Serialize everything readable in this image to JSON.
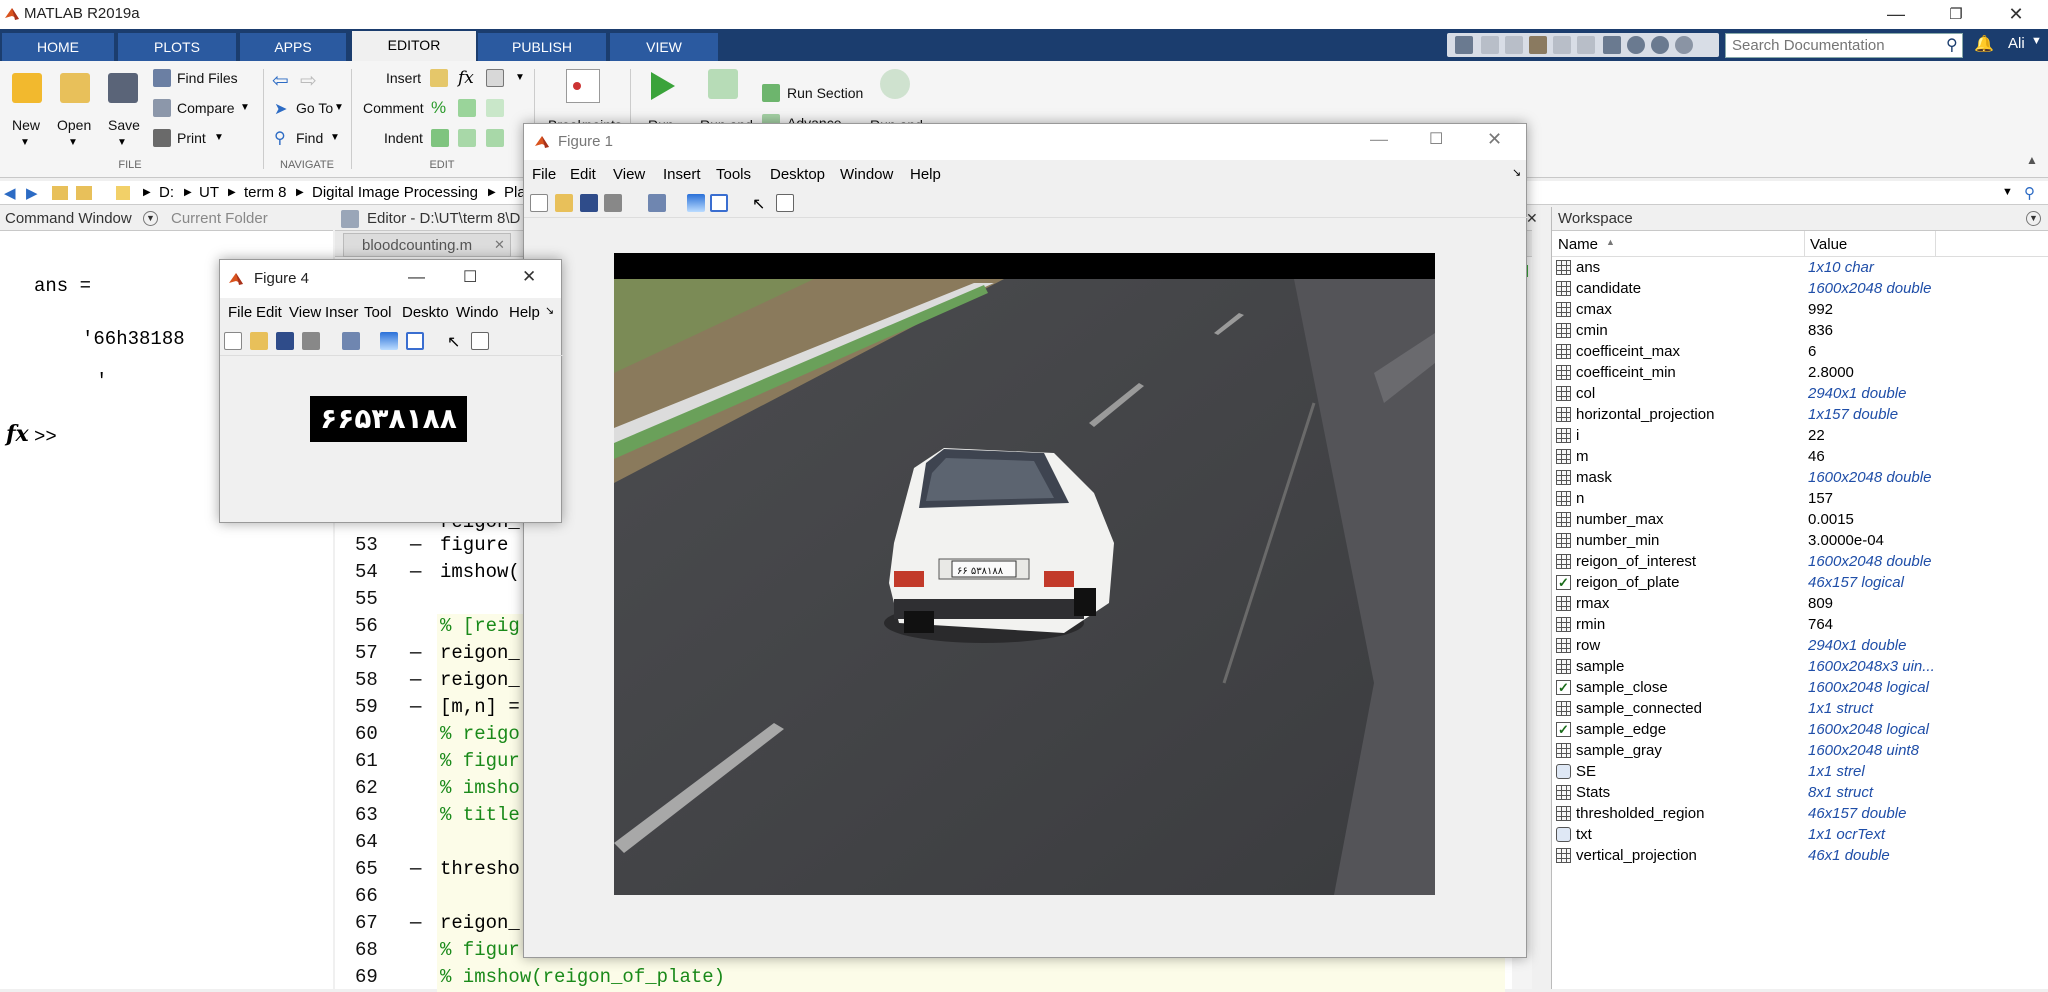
{
  "app": {
    "title": "MATLAB R2019a",
    "user": "Ali",
    "search_placeholder": "Search Documentation"
  },
  "ribbon": {
    "tabs": [
      "HOME",
      "PLOTS",
      "APPS",
      "EDITOR",
      "PUBLISH",
      "VIEW"
    ],
    "active_tab": "EDITOR",
    "file": {
      "new": "New",
      "open": "Open",
      "save": "Save",
      "find_files": "Find Files",
      "compare": "Compare",
      "print": "Print",
      "section": "FILE"
    },
    "navigate": {
      "go_to": "Go To",
      "find": "Find",
      "section": "NAVIGATE"
    },
    "edit": {
      "insert": "Insert",
      "comment": "Comment",
      "indent": "Indent",
      "section": "EDIT"
    },
    "run": {
      "breakpoints": "Breakpoints",
      "run": "Run",
      "run_and": "Run and",
      "run_section": "Run Section",
      "advance": "Advance",
      "run_and2": "Run and"
    }
  },
  "address": {
    "parts": [
      "D:",
      "UT",
      "term 8",
      "Digital Image Processing",
      "Pla"
    ]
  },
  "command_window": {
    "tab": "Command Window",
    "tab2": "Current Folder",
    "ans_label": "ans =",
    "ans_value": "'66h38188",
    "ans_end": "'",
    "prompt": ">>",
    "fx": "fx"
  },
  "editor": {
    "title": "Editor - D:\\UT\\term 8\\D",
    "file_tab": "bloodcounting.m",
    "lines": [
      {
        "n": "53",
        "dash": true,
        "code": "figure",
        "comment": false,
        "hl": false
      },
      {
        "n": "54",
        "dash": true,
        "code": "imshow(",
        "comment": false,
        "hl": false
      },
      {
        "n": "55",
        "dash": false,
        "code": "",
        "comment": false,
        "hl": false
      },
      {
        "n": "56",
        "dash": false,
        "code": "% [reig",
        "comment": true,
        "hl": true
      },
      {
        "n": "57",
        "dash": true,
        "code": "reigon_",
        "comment": false,
        "hl": true
      },
      {
        "n": "58",
        "dash": true,
        "code": "reigon_",
        "comment": false,
        "hl": true
      },
      {
        "n": "59",
        "dash": true,
        "code": "[m,n] =",
        "comment": false,
        "hl": true
      },
      {
        "n": "60",
        "dash": false,
        "code": "% reigo",
        "comment": true,
        "hl": true
      },
      {
        "n": "61",
        "dash": false,
        "code": "% figur",
        "comment": true,
        "hl": true
      },
      {
        "n": "62",
        "dash": false,
        "code": "% imsho",
        "comment": true,
        "hl": true
      },
      {
        "n": "63",
        "dash": false,
        "code": "% title",
        "comment": true,
        "hl": true
      },
      {
        "n": "64",
        "dash": false,
        "code": "",
        "comment": false,
        "hl": true
      },
      {
        "n": "65",
        "dash": true,
        "code": "thresho",
        "comment": false,
        "hl": true
      },
      {
        "n": "66",
        "dash": false,
        "code": "",
        "comment": false,
        "hl": true
      },
      {
        "n": "67",
        "dash": true,
        "code": "reigon_",
        "comment": false,
        "hl": true
      },
      {
        "n": "68",
        "dash": false,
        "code": "% figur",
        "comment": true,
        "hl": true
      },
      {
        "n": "69",
        "dash": false,
        "code": "% imshow(reigon_of_plate)",
        "comment": true,
        "hl": true
      }
    ],
    "partial_line": "reigon_"
  },
  "workspace": {
    "title": "Workspace",
    "col_name": "Name",
    "col_value": "Value",
    "vars": [
      {
        "name": "ans",
        "value": "1x10 char",
        "italic": true,
        "icon": "grid"
      },
      {
        "name": "candidate",
        "value": "1600x2048 double",
        "italic": true,
        "icon": "grid"
      },
      {
        "name": "cmax",
        "value": "992",
        "italic": false,
        "icon": "grid"
      },
      {
        "name": "cmin",
        "value": "836",
        "italic": false,
        "icon": "grid"
      },
      {
        "name": "coefficeint_max",
        "value": "6",
        "italic": false,
        "icon": "grid"
      },
      {
        "name": "coefficeint_min",
        "value": "2.8000",
        "italic": false,
        "icon": "grid"
      },
      {
        "name": "col",
        "value": "2940x1 double",
        "italic": true,
        "icon": "grid"
      },
      {
        "name": "horizontal_projection",
        "value": "1x157 double",
        "italic": true,
        "icon": "grid"
      },
      {
        "name": "i",
        "value": "22",
        "italic": false,
        "icon": "grid"
      },
      {
        "name": "m",
        "value": "46",
        "italic": false,
        "icon": "grid"
      },
      {
        "name": "mask",
        "value": "1600x2048 double",
        "italic": true,
        "icon": "grid"
      },
      {
        "name": "n",
        "value": "157",
        "italic": false,
        "icon": "grid"
      },
      {
        "name": "number_max",
        "value": "0.0015",
        "italic": false,
        "icon": "grid"
      },
      {
        "name": "number_min",
        "value": "3.0000e-04",
        "italic": false,
        "icon": "grid"
      },
      {
        "name": "reigon_of_interest",
        "value": "1600x2048 double",
        "italic": true,
        "icon": "grid"
      },
      {
        "name": "reigon_of_plate",
        "value": "46x157 logical",
        "italic": true,
        "icon": "chk"
      },
      {
        "name": "rmax",
        "value": "809",
        "italic": false,
        "icon": "grid"
      },
      {
        "name": "rmin",
        "value": "764",
        "italic": false,
        "icon": "grid"
      },
      {
        "name": "row",
        "value": "2940x1 double",
        "italic": true,
        "icon": "grid"
      },
      {
        "name": "sample",
        "value": "1600x2048x3 uin...",
        "italic": true,
        "icon": "grid"
      },
      {
        "name": "sample_close",
        "value": "1600x2048 logical",
        "italic": true,
        "icon": "chk"
      },
      {
        "name": "sample_connected",
        "value": "1x1 struct",
        "italic": true,
        "icon": "grid"
      },
      {
        "name": "sample_edge",
        "value": "1600x2048 logical",
        "italic": true,
        "icon": "chk"
      },
      {
        "name": "sample_gray",
        "value": "1600x2048 uint8",
        "italic": true,
        "icon": "grid"
      },
      {
        "name": "SE",
        "value": "1x1 strel",
        "italic": true,
        "icon": "obj"
      },
      {
        "name": "Stats",
        "value": "8x1 struct",
        "italic": true,
        "icon": "grid"
      },
      {
        "name": "thresholded_region",
        "value": "46x157 double",
        "italic": true,
        "icon": "grid"
      },
      {
        "name": "txt",
        "value": "1x1 ocrText",
        "italic": true,
        "icon": "obj"
      },
      {
        "name": "vertical_projection",
        "value": "46x1 double",
        "italic": true,
        "icon": "grid"
      }
    ]
  },
  "figure1": {
    "title": "Figure 1",
    "menu": [
      "File",
      "Edit",
      "View",
      "Insert",
      "Tools",
      "Desktop",
      "Window",
      "Help"
    ],
    "plate_text": "۶۶ ۵۳۸۱۸۸"
  },
  "figure4": {
    "title": "Figure 4",
    "menu": [
      "File",
      "Edit",
      "View",
      "Inser",
      "Tool",
      "Deskto",
      "Windo",
      "Help"
    ],
    "plate_text": "۶۶۵۳۸۱۸۸"
  }
}
